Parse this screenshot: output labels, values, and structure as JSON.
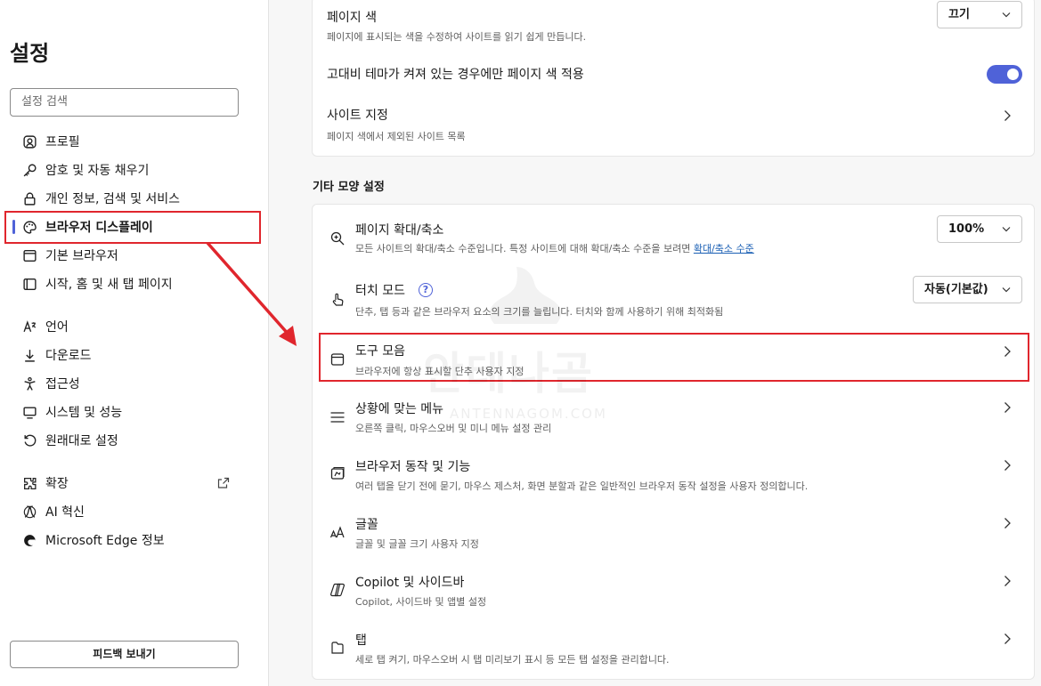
{
  "sidebar": {
    "title": "설정",
    "search_placeholder": "설정 검색",
    "items": [
      {
        "label": "프로필",
        "icon": "profile-icon"
      },
      {
        "label": "암호 및 자동 채우기",
        "icon": "key-icon"
      },
      {
        "label": "개인 정보, 검색 및 서비스",
        "icon": "lock-icon"
      },
      {
        "label": "브라우저 디스플레이",
        "icon": "palette-icon",
        "active": true
      },
      {
        "label": "기본 브라우저",
        "icon": "browser-icon"
      },
      {
        "label": "시작, 홈 및 새 탭 페이지",
        "icon": "home-tab-icon"
      },
      {
        "label": "언어",
        "icon": "language-icon"
      },
      {
        "label": "다운로드",
        "icon": "download-icon"
      },
      {
        "label": "접근성",
        "icon": "accessibility-icon"
      },
      {
        "label": "시스템 및 성능",
        "icon": "system-icon"
      },
      {
        "label": "원래대로 설정",
        "icon": "reset-icon"
      },
      {
        "label": "확장",
        "icon": "extensions-icon"
      },
      {
        "label": "AI 혁신",
        "icon": "ai-icon"
      },
      {
        "label": "Microsoft Edge 정보",
        "icon": "edge-logo-icon"
      }
    ],
    "feedback_label": "피드백 보내기"
  },
  "page_color": {
    "title": "페이지 색",
    "desc": "페이지에 표시되는 색을 수정하여 사이트를 읽기 쉽게 만듭니다.",
    "select_value": "끄기",
    "high_contrast_label": "고대비 테마가 켜져 있는 경우에만 페이지 색 적용",
    "high_contrast_on": true,
    "site_title": "사이트 지정",
    "site_desc": "페이지 색에서 제외된 사이트 목록"
  },
  "section_title": "기타 모양 설정",
  "zoom": {
    "title": "페이지 확대/축소",
    "desc": "모든 사이트의 확대/축소 수준입니다. 특정 사이트에 대해 확대/축소 수준을 보려면",
    "link": "확대/축소 수준",
    "value": "100%"
  },
  "touch": {
    "title": "터치 모드",
    "help": "?",
    "desc": "단추, 탭 등과 같은 브라우저 요소의 크기를 늘립니다. 터치와 함께 사용하기 위해 최적화됨",
    "value": "자동(기본값)"
  },
  "rows": [
    {
      "title": "도구 모음",
      "desc": "브라우저에 항상 표시할 단추 사용자 지정",
      "icon": "toolbar-icon"
    },
    {
      "title": "상황에 맞는 메뉴",
      "desc": "오른쪽 클릭, 마우스오버 및 미니 메뉴 설정 관리",
      "icon": "menu-icon"
    },
    {
      "title": "브라우저 동작 및 기능",
      "desc": "여러 탭을 닫기 전에 묻기, 마우스 제스처, 화면 분할과 같은 일반적인 브라우저 동작 설정을 사용자 정의합니다.",
      "icon": "browser-behavior-icon"
    },
    {
      "title": "글꼴",
      "desc": "글꼴 및 글꼴 크기 사용자 지정",
      "icon": "font-icon"
    },
    {
      "title": "Copilot 및 사이드바",
      "desc": "Copilot, 사이드바 및 앱별 설정",
      "icon": "copilot-icon"
    },
    {
      "title": "탭",
      "desc": "세로 탭 켜기, 마우스오버 시 탭 미리보기 표시 등 모든 탭 설정을 관리합니다.",
      "icon": "tab-icon"
    }
  ],
  "watermark": {
    "text": "안테나곰",
    "sub": "ANTENNAGOM.COM"
  },
  "colors": {
    "accent": "#4f62d8",
    "highlight": "#e0262d"
  }
}
